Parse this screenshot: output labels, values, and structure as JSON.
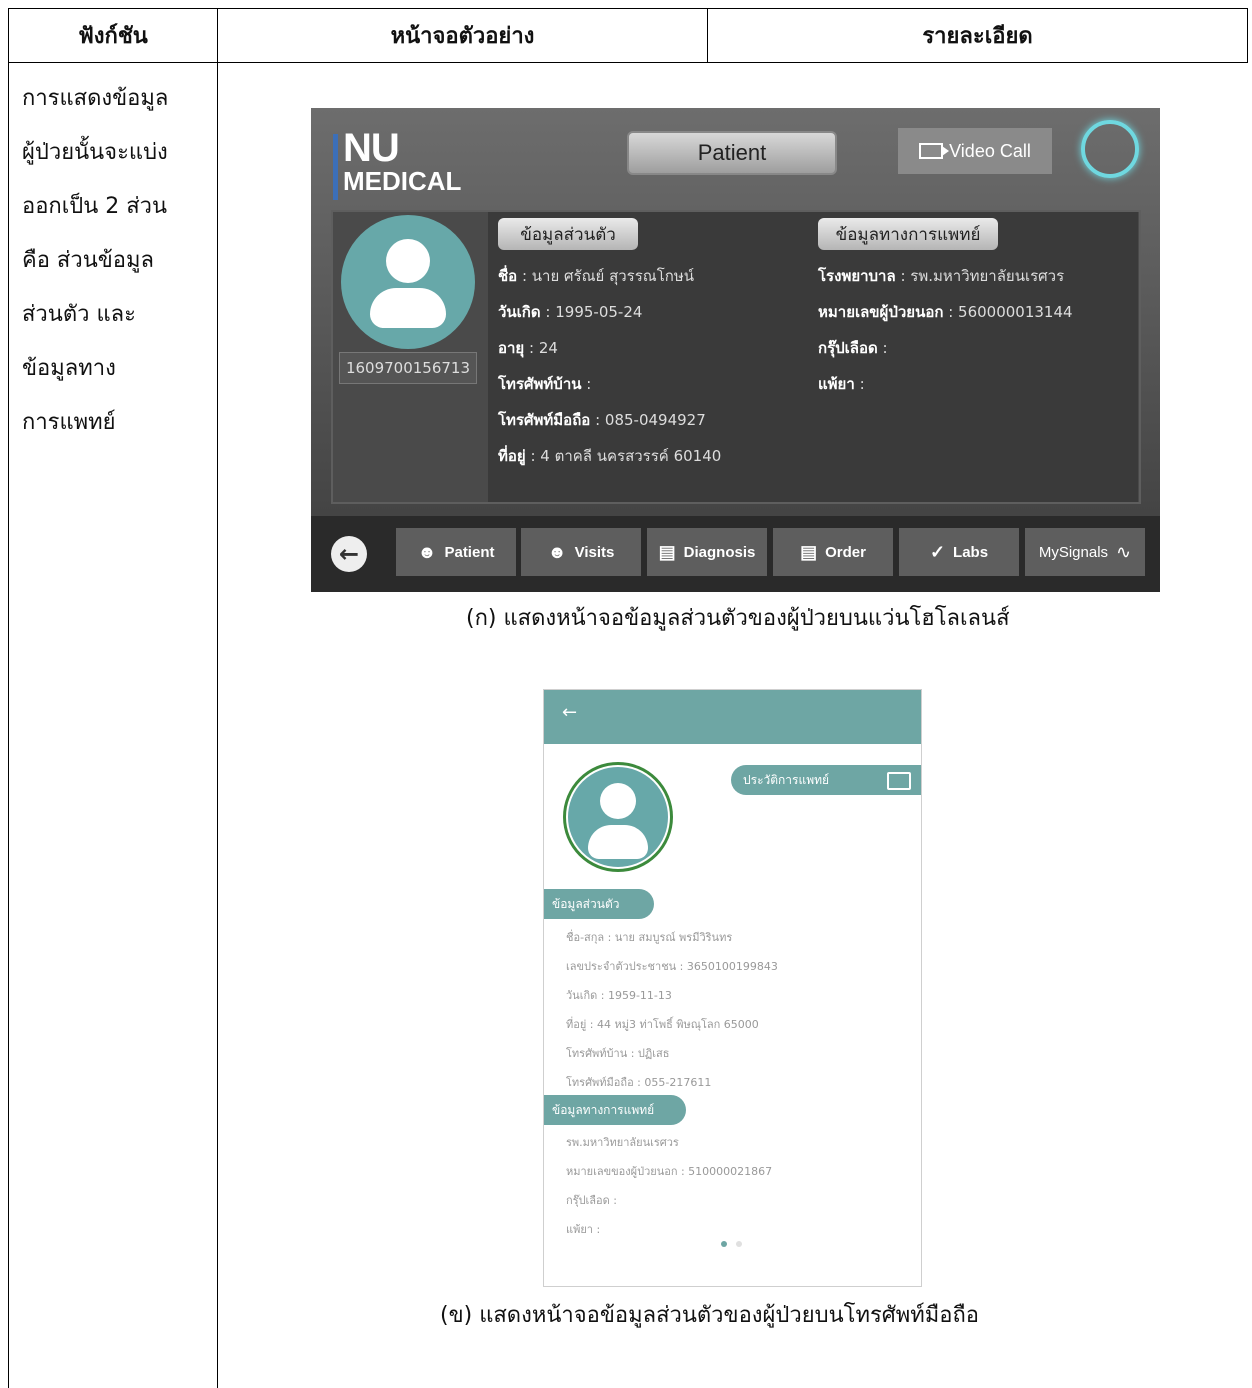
{
  "table": {
    "headers": [
      "ฟังก์ชัน",
      "หน้าจอตัวอย่าง",
      "รายละเอียด"
    ],
    "description_lines": [
      "การแสดงข้อมูล",
      "ผู้ป่วยนั้นจะแบ่ง",
      "ออกเป็น 2 ส่วน",
      "คือ ส่วนข้อมูล",
      "ส่วนตัว และ",
      "ข้อมูลทาง",
      "การแพทย์"
    ]
  },
  "hololens": {
    "logo_nu": "NU",
    "logo_medical": "MEDICAL",
    "title": "Patient",
    "video_call": "Video Call",
    "patient_id": "1609700156713",
    "personal_header": "ข้อมูลส่วนตัว",
    "medical_header": "ข้อมูลทางการแพทย์",
    "personal": [
      {
        "label": "ชื่อ",
        "value": ": นาย ศรัณย์ สุวรรณโกษน์"
      },
      {
        "label": "วันเกิด",
        "value": ": 1995-05-24"
      },
      {
        "label": "อายุ",
        "value": ": 24"
      },
      {
        "label": "โทรศัพท์บ้าน",
        "value": ":"
      },
      {
        "label": "โทรศัพท์มือถือ",
        "value": ": 085-0494927"
      },
      {
        "label": "ที่อยู่",
        "value": ": 4 ตาคลี นครสวรรค์ 60140"
      }
    ],
    "medical": [
      {
        "label": "โรงพยาบาล",
        "value": ": รพ.มหาวิทยาลัยนเรศวร"
      },
      {
        "label": "หมายเลขผู้ป่วยนอก",
        "value": ": 560000013144"
      },
      {
        "label": "กรุ๊ปเลือด",
        "value": ":"
      },
      {
        "label": "แพ้ยา",
        "value": ":"
      }
    ],
    "nav": [
      "Patient",
      "Visits",
      "Diagnosis",
      "Order",
      "Labs",
      "MySignals"
    ]
  },
  "caption_a": "(ก) แสดงหน้าจอข้อมูลส่วนตัวของผู้ป่วยบนแว่นโฮโลเลนส์",
  "mobile": {
    "back": "←",
    "history_label": "ประวัติการแพทย์",
    "personal_header": "ข้อมูลส่วนตัว",
    "medical_header": "ข้อมูลทางการแพทย์",
    "personal_rows": [
      "ชื่อ-สกุล : นาย สมบูรณ์ พรมีวิรินทร",
      "เลขประจำตัวประชาชน : 3650100199843",
      "วันเกิด : 1959-11-13",
      "ที่อยู่ : 44 หมู่3 ท่าโพธิ์ พิษณุโลก 65000",
      "โทรศัพท์บ้าน : ปฏิเสธ",
      "โทรศัพท์มือถือ : 055-217611"
    ],
    "medical_rows": [
      "รพ.มหาวิทยาลัยนเรศวร",
      "หมายเลขของผู้ป่วยนอก : 510000021867",
      "กรุ๊ปเลือด :",
      "แพ้ยา :"
    ]
  },
  "caption_b": "(ข) แสดงหน้าจอข้อมูลส่วนตัวของผู้ป่วยบนโทรศัพท์มือถือ"
}
